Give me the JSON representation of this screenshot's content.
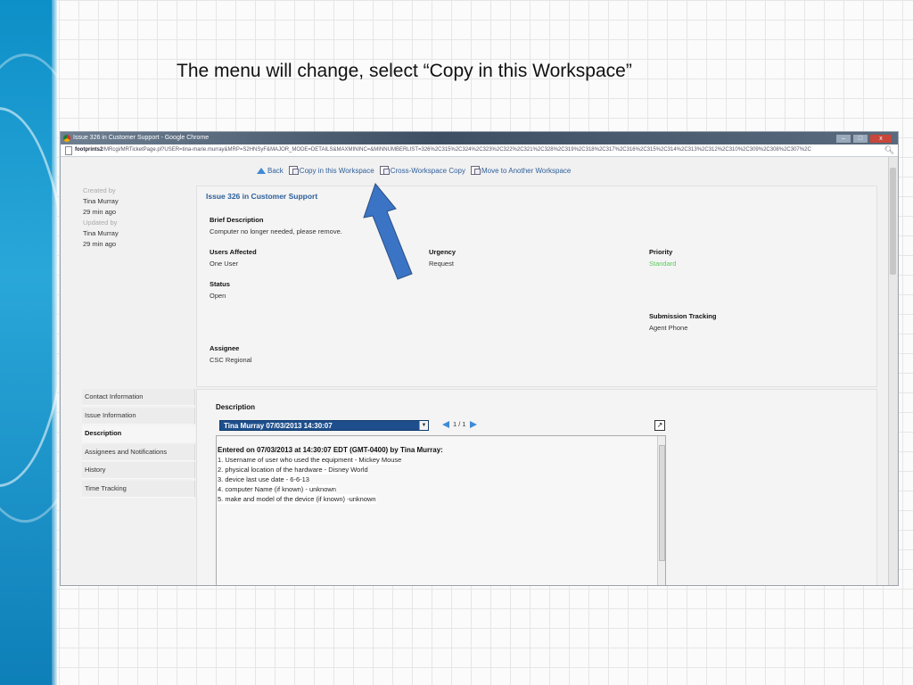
{
  "slide": {
    "caption": "The menu will change, select “Copy in this Workspace”"
  },
  "browser": {
    "window_title": "Issue 326 in Customer Support - Google Chrome",
    "url_host": "footprints2",
    "url_path": "/MRcgi/MRTicketPage.pl?USER=tina-marie.murray&MRP=S2HNSyF&MAJOR_MODE=DETAILS&MAXMININC=&MINNUMBERLIST=326%2C315%2C324%2C323%2C322%2C321%2C328%2C319%2C318%2C317%2C316%2C315%2C314%2C313%2C312%2C310%2C309%2C308%2C307%2C",
    "win_buttons": [
      "–",
      "□",
      "x"
    ]
  },
  "toolbar": {
    "back": "Back",
    "copy_in_workspace": "Copy in this Workspace",
    "cross_workspace": "Cross-Workspace Copy",
    "move": "Move to Another Workspace"
  },
  "meta": {
    "created_by_label": "Created by",
    "created_by_name": "Tina Murray",
    "created_time": "29 min ago",
    "updated_by_label": "Updated by",
    "updated_by_name": "Tina Murray",
    "updated_time": "29 min ago"
  },
  "issue": {
    "title": "Issue 326 in Customer Support",
    "brief_description_label": "Brief Description",
    "brief_description": "Computer no longer needed, please remove.",
    "users_affected_label": "Users Affected",
    "users_affected": "One User",
    "urgency_label": "Urgency",
    "urgency": "Request",
    "priority_label": "Priority",
    "priority": "Standard",
    "status_label": "Status",
    "status": "Open",
    "submission_tracking_label": "Submission Tracking",
    "submission_tracking": "Agent Phone",
    "assignee_label": "Assignee",
    "assignee": "CSC Regional",
    "priority_color": "#5ecb5e"
  },
  "tabs": [
    {
      "label": "Contact Information"
    },
    {
      "label": "Issue Information"
    },
    {
      "label": "Description"
    },
    {
      "label": "Assignees and Notifications"
    },
    {
      "label": "History"
    },
    {
      "label": "Time Tracking"
    }
  ],
  "description": {
    "label": "Description",
    "selected_entry": "Tina Murray 07/03/2013 14:30:07",
    "pager": "1 / 1",
    "entry_header": "Entered on 07/03/2013 at 14:30:07 EDT (GMT-0400) by Tina Murray:",
    "lines": [
      "1. Username of user who used the equipment - Mickey Mouse",
      "2. physical location of the hardware - Disney World",
      "3. device last use date - 6-6-13",
      "4. computer Name (if known) - unknown",
      "5. make and model of the device (if known) -unknown"
    ]
  },
  "colors": {
    "accent": "#2c5f99",
    "select_bg": "#1e4f8c",
    "pointer_arrow": "#3b74c4"
  }
}
